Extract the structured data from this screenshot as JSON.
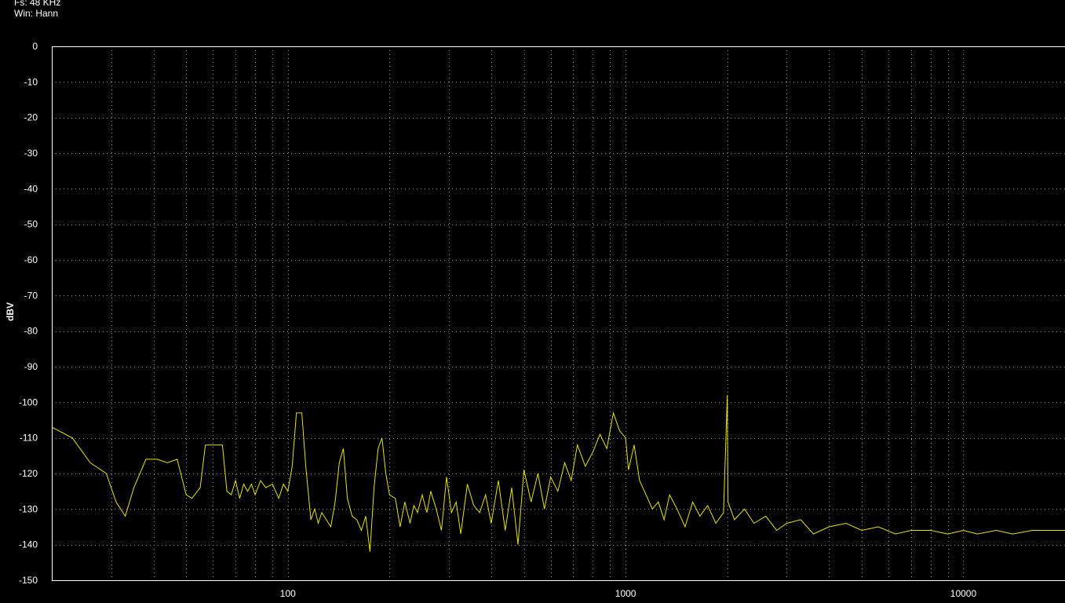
{
  "info": {
    "fs": "Fs: 48 KHz",
    "window": "Win: Hann"
  },
  "colors": {
    "background": "#000000",
    "axis": "#ffffff",
    "grid": "#9a9a9a",
    "trace": "#e8e400",
    "text": "#ffffff"
  },
  "chart_data": {
    "type": "line",
    "title": "",
    "xlabel": "",
    "ylabel": "dBV",
    "x_scale": "log",
    "xlim": [
      20,
      20000
    ],
    "ylim": [
      -150,
      0
    ],
    "y_ticks": [
      0,
      -10,
      -20,
      -30,
      -40,
      -50,
      -60,
      -70,
      -80,
      -90,
      -100,
      -110,
      -120,
      -130,
      -140,
      -150
    ],
    "y_tick_labels": [
      "0",
      "-10",
      "-20",
      "-30",
      "-40",
      "-50",
      "-60",
      "-70",
      "-80",
      "-90",
      "-100",
      "-110",
      "-120",
      "-130",
      "-140",
      "-150"
    ],
    "x_ticks": [
      100,
      1000,
      10000
    ],
    "x_tick_labels": [
      "100",
      "1000",
      "10000"
    ],
    "grid": true,
    "series": [
      {
        "values_note": "",
        "x": [
          20,
          23,
          26,
          29,
          31,
          33,
          35,
          38,
          41,
          44,
          47,
          50,
          52,
          55,
          57,
          60,
          62,
          64,
          66,
          68,
          70,
          72,
          74,
          76,
          78,
          80,
          83,
          86,
          90,
          94,
          97,
          100,
          103,
          106,
          110,
          113,
          117,
          120,
          123,
          126,
          130,
          134,
          138,
          142,
          146,
          150,
          155,
          160,
          165,
          170,
          175,
          180,
          185,
          190,
          195,
          200,
          208,
          215,
          222,
          230,
          236,
          242,
          250,
          258,
          265,
          275,
          285,
          295,
          305,
          315,
          325,
          340,
          355,
          370,
          385,
          400,
          420,
          440,
          460,
          480,
          500,
          525,
          550,
          575,
          600,
          630,
          660,
          690,
          720,
          760,
          800,
          840,
          880,
          920,
          960,
          1000,
          1020,
          1060,
          1100,
          1150,
          1200,
          1250,
          1300,
          1350,
          1420,
          1500,
          1580,
          1660,
          1750,
          1850,
          1950,
          2000,
          2010,
          2100,
          2250,
          2400,
          2600,
          2800,
          3000,
          3300,
          3600,
          4000,
          4500,
          5000,
          5600,
          6300,
          7000,
          8000,
          9000,
          10000,
          11000,
          12500,
          14000,
          16000,
          18000,
          20000
        ],
        "values": [
          -107,
          -110,
          -117,
          -120,
          -128,
          -132,
          -124,
          -116,
          -116,
          -117,
          -116,
          -126,
          -127,
          -124,
          -112,
          -112,
          -112,
          -112,
          -125,
          -126,
          -122,
          -127,
          -123,
          -125,
          -123,
          -126,
          -122,
          -124,
          -123,
          -127,
          -123,
          -125,
          -118,
          -103,
          -103,
          -118,
          -133,
          -130,
          -134,
          -131,
          -133,
          -135,
          -128,
          -117,
          -113,
          -127,
          -132,
          -133,
          -136,
          -132,
          -142,
          -124,
          -113,
          -110,
          -120,
          -126,
          -127,
          -135,
          -128,
          -134,
          -129,
          -131,
          -126,
          -131,
          -125,
          -130,
          -136,
          -121,
          -131,
          -128,
          -137,
          -123,
          -129,
          -131,
          -126,
          -134,
          -122,
          -136,
          -124,
          -140,
          -119,
          -128,
          -120,
          -130,
          -121,
          -125,
          -117,
          -122,
          -112,
          -118,
          -114,
          -109,
          -113,
          -103,
          -108,
          -110,
          -119,
          -112,
          -122,
          -126,
          -130,
          -128,
          -133,
          -126,
          -130,
          -135,
          -128,
          -132,
          -129,
          -134,
          -131,
          -98,
          -128,
          -133,
          -130,
          -134,
          -132,
          -136,
          -134,
          -133,
          -137,
          -135,
          -134,
          -136,
          -135,
          -137,
          -136,
          -136,
          -137,
          -136,
          -137,
          -136,
          -137,
          -136,
          -136,
          -136
        ]
      }
    ]
  }
}
